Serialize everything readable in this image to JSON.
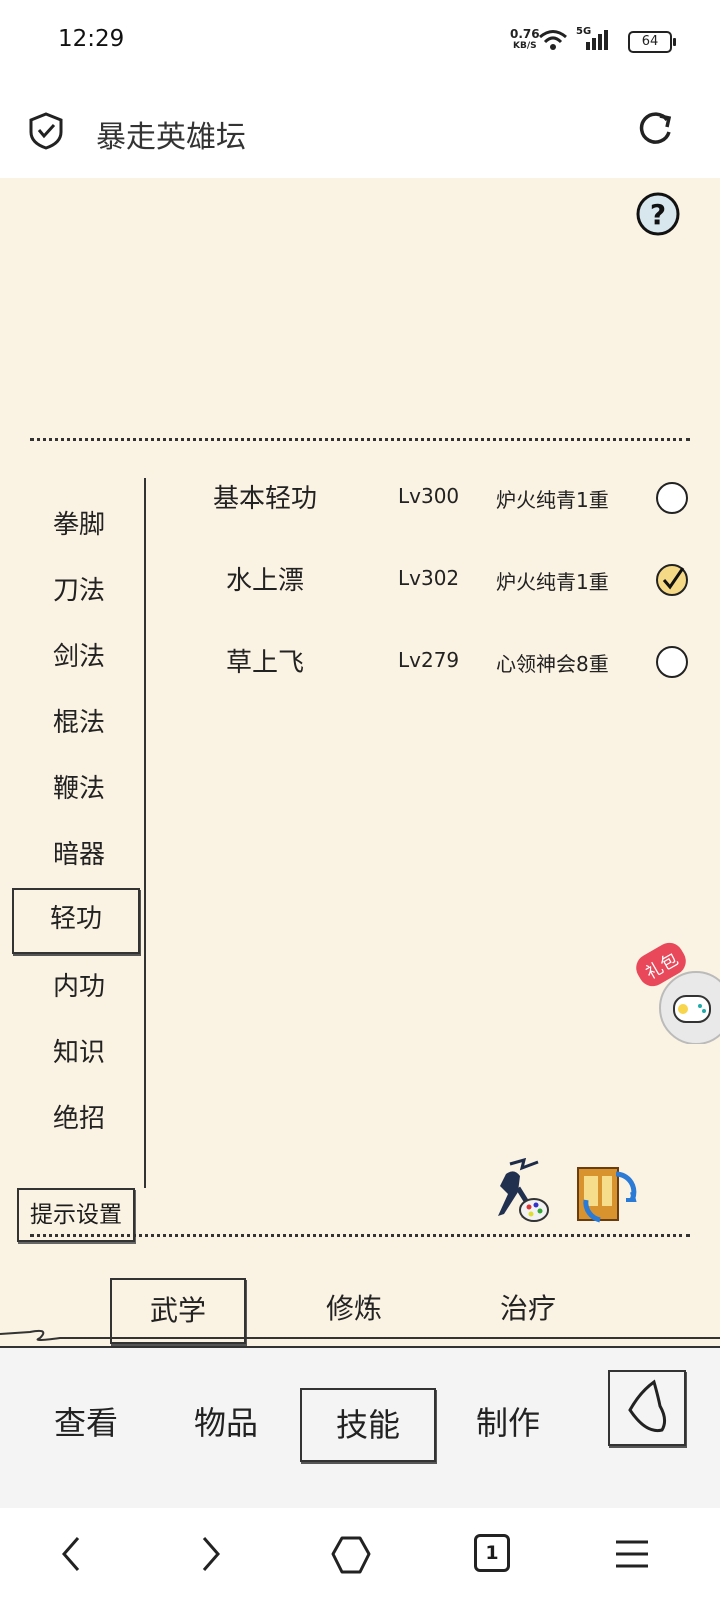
{
  "status": {
    "time": "12:29",
    "net_speed_value": "0.76",
    "net_speed_unit": "KB/S",
    "signal": "5G",
    "battery": "64"
  },
  "header": {
    "title": "暴走英雄坛"
  },
  "categories": [
    {
      "label": "拳脚"
    },
    {
      "label": "刀法"
    },
    {
      "label": "剑法"
    },
    {
      "label": "棍法"
    },
    {
      "label": "鞭法"
    },
    {
      "label": "暗器"
    },
    {
      "label": "轻功",
      "selected": true
    },
    {
      "label": "内功"
    },
    {
      "label": "知识"
    },
    {
      "label": "绝招"
    }
  ],
  "skills": [
    {
      "name": "基本轻功",
      "level": "Lv300",
      "rank": "炉火纯青1重",
      "equipped": false
    },
    {
      "name": "水上漂",
      "level": "Lv302",
      "rank": "炉火纯青1重",
      "equipped": true
    },
    {
      "name": "草上飞",
      "level": "Lv279",
      "rank": "心领神会8重",
      "equipped": false
    }
  ],
  "tips_button": "提示设置",
  "sub_tabs": [
    {
      "label": "武学",
      "selected": true
    },
    {
      "label": "修炼"
    },
    {
      "label": "治疗"
    }
  ],
  "gift_badge": "礼包",
  "bottom_tabs": [
    {
      "label": "查看"
    },
    {
      "label": "物品"
    },
    {
      "label": "技能",
      "selected": true
    },
    {
      "label": "制作"
    }
  ],
  "nav": {
    "tab_count": "1"
  }
}
